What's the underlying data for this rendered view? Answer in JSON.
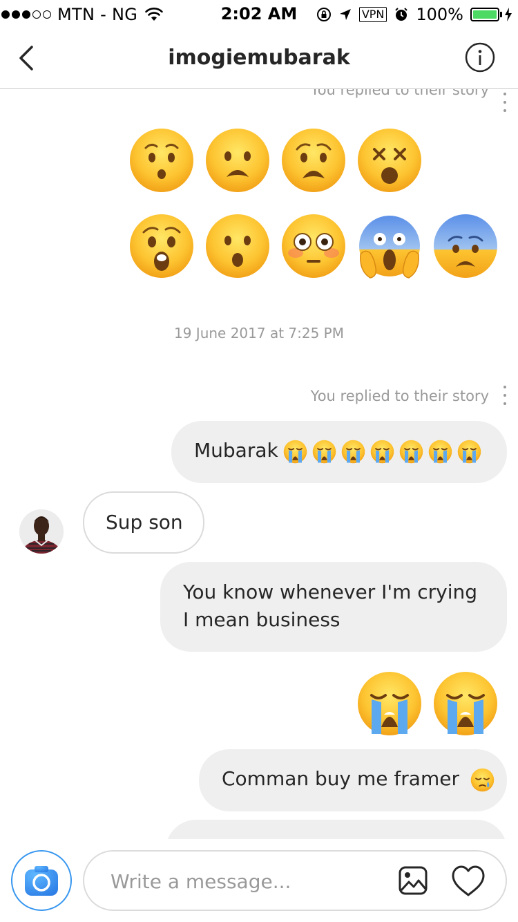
{
  "status_bar": {
    "carrier": "MTN - NG",
    "time": "2:02 AM",
    "vpn": "VPN",
    "battery": "100%",
    "battery_color": "#4cd964"
  },
  "header": {
    "title": "imogiemubarak",
    "back_icon": "chevron-left-icon",
    "info_icon": "info-icon"
  },
  "messages": {
    "story_reply_label_top": "You replied to their story",
    "emoji_row_1": [
      "hushed",
      "frowning",
      "anguished",
      "dizzy"
    ],
    "emoji_row_2": [
      "astonished",
      "open-mouth",
      "flushed",
      "scream",
      "fearful"
    ],
    "timestamp": "19 June 2017 at 7:25 PM",
    "story_reply_label": "You replied to their story",
    "msg1_text": "Mubarak",
    "msg1_emoji_count": 7,
    "msg2_text": "Sup son",
    "msg3_text": "You know whenever I'm crying I mean business",
    "msg4_emoji": [
      "crying",
      "crying"
    ],
    "msg5_text": "Comman buy me framer",
    "msg5_emoji": "sleepy"
  },
  "composer": {
    "placeholder": "Write a message...",
    "camera_icon": "camera-icon",
    "gallery_icon": "image-icon",
    "heart_icon": "heart-icon",
    "accent_color": "#3897f0"
  }
}
